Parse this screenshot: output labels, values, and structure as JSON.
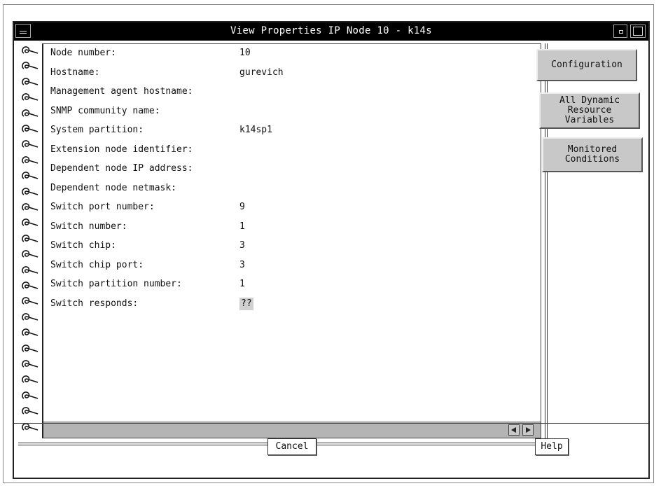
{
  "window": {
    "title": "View Properties IP Node 10 - k14s"
  },
  "properties": [
    {
      "label": "Node number:",
      "value": "10"
    },
    {
      "label": "Hostname:",
      "value": "gurevich"
    },
    {
      "label": "Management agent hostname:",
      "value": ""
    },
    {
      "label": "SNMP community name:",
      "value": ""
    },
    {
      "label": "System partition:",
      "value": "k14sp1"
    },
    {
      "label": "Extension node identifier:",
      "value": ""
    },
    {
      "label": "Dependent node IP address:",
      "value": ""
    },
    {
      "label": "Dependent node netmask:",
      "value": ""
    },
    {
      "label": "Switch port number:",
      "value": "9"
    },
    {
      "label": "Switch number:",
      "value": "1"
    },
    {
      "label": "Switch chip:",
      "value": "3"
    },
    {
      "label": "Switch chip port:",
      "value": "3"
    },
    {
      "label": "Switch partition number:",
      "value": "1"
    },
    {
      "label": "Switch responds:",
      "value": "??"
    }
  ],
  "tabs": {
    "configuration": "Configuration",
    "dynamic": "All Dynamic\nResource\nVariables",
    "monitored": "Monitored\nConditions"
  },
  "buttons": {
    "cancel": "Cancel",
    "help": "Help"
  },
  "icons": {
    "window_menu": "window-menu-icon",
    "minimize": "minimize-icon",
    "maximize": "maximize-icon",
    "scroll_left": "arrow-left-icon",
    "scroll_right": "arrow-right-icon",
    "spiral": "notebook-spiral-icon"
  }
}
